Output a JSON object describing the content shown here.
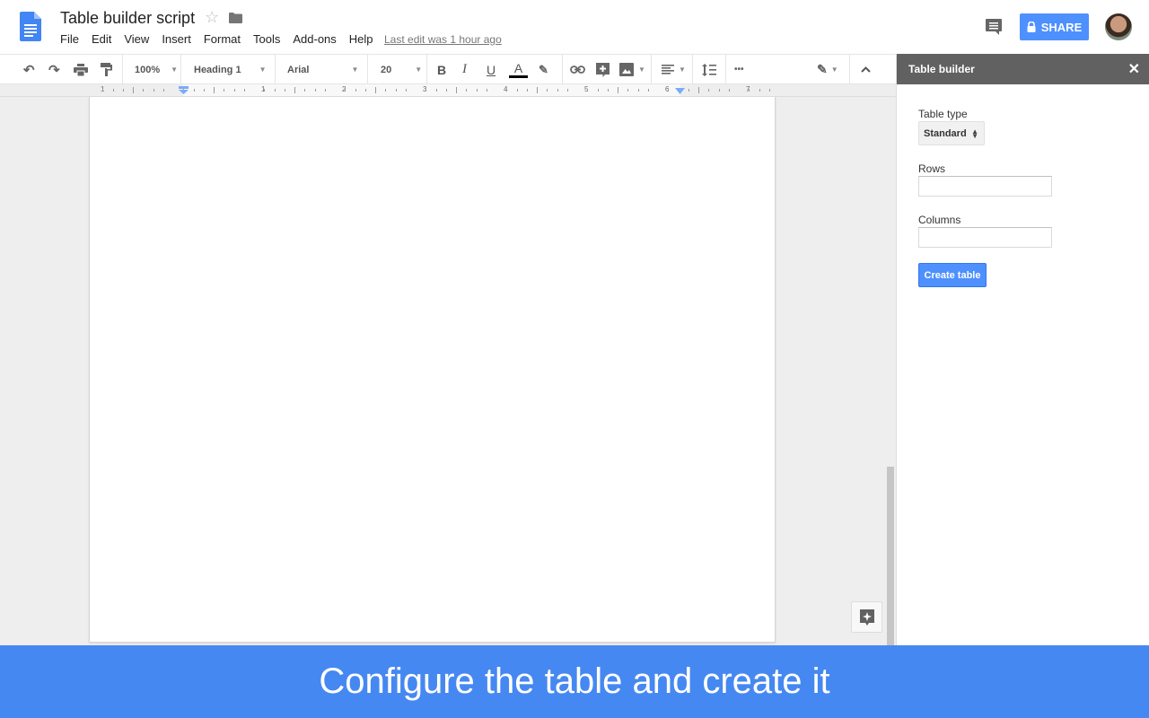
{
  "header": {
    "title": "Table builder script",
    "menu": [
      "File",
      "Edit",
      "View",
      "Insert",
      "Format",
      "Tools",
      "Add-ons",
      "Help"
    ],
    "last_edit": "Last edit was 1 hour ago",
    "share_label": "SHARE",
    "icons": {
      "logo": "docs-logo-icon",
      "star": "star-icon",
      "folder": "folder-icon",
      "comments": "comments-icon",
      "lock": "lock-icon"
    }
  },
  "toolbar": {
    "zoom": "100%",
    "style": "Heading 1",
    "font": "Arial",
    "size": "20",
    "bold": "B",
    "italic": "I",
    "underline": "U",
    "text_color": "A",
    "more": "•••",
    "text_color_value": "#000000"
  },
  "ruler": {
    "numbers": [
      "1",
      "1",
      "2",
      "3",
      "4",
      "5",
      "6",
      "7"
    ]
  },
  "sidebar": {
    "title": "Table builder",
    "close": "✕",
    "table_type_label": "Table type",
    "table_type_value": "Standard",
    "rows_label": "Rows",
    "rows_value": "",
    "columns_label": "Columns",
    "columns_value": "",
    "create_button": "Create table"
  },
  "caption": "Configure the table and create it",
  "colors": {
    "accent": "#4d90fe",
    "caption_bg": "#4688f1",
    "sidebar_header": "#616161"
  }
}
